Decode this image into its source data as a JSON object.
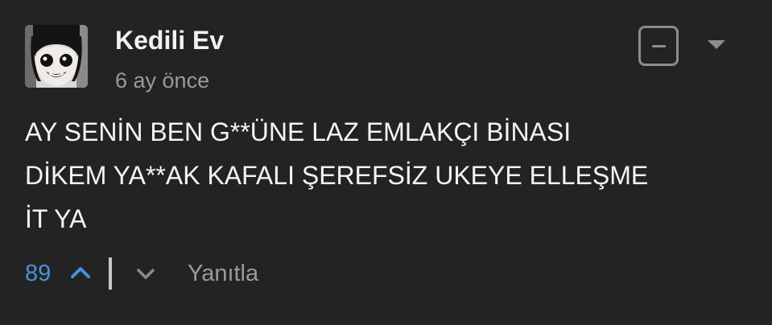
{
  "comment": {
    "username": "Kedili Ev",
    "timestamp": "6 ay önce",
    "body": "AY SENİN BEN G**ÜNE LAZ EMLAKÇI BİNASI\nDİKEM YA**AK KAFALI ŞEREFSİZ UKEYE ELLEŞME\nİT YA",
    "avatar_icon": "anime-girl-avatar"
  },
  "actions": {
    "vote_count": "89",
    "upvote_icon": "chevron-up-icon",
    "downvote_icon": "chevron-down-icon",
    "reply_label": "Yanıtla"
  },
  "header_controls": {
    "collapse_icon": "minus-square-icon",
    "menu_icon": "caret-down-icon"
  },
  "colors": {
    "background": "#232323",
    "vote_accent": "#4a90d9",
    "muted_text": "#9a9a9a",
    "body_text": "#f4f4f4"
  }
}
